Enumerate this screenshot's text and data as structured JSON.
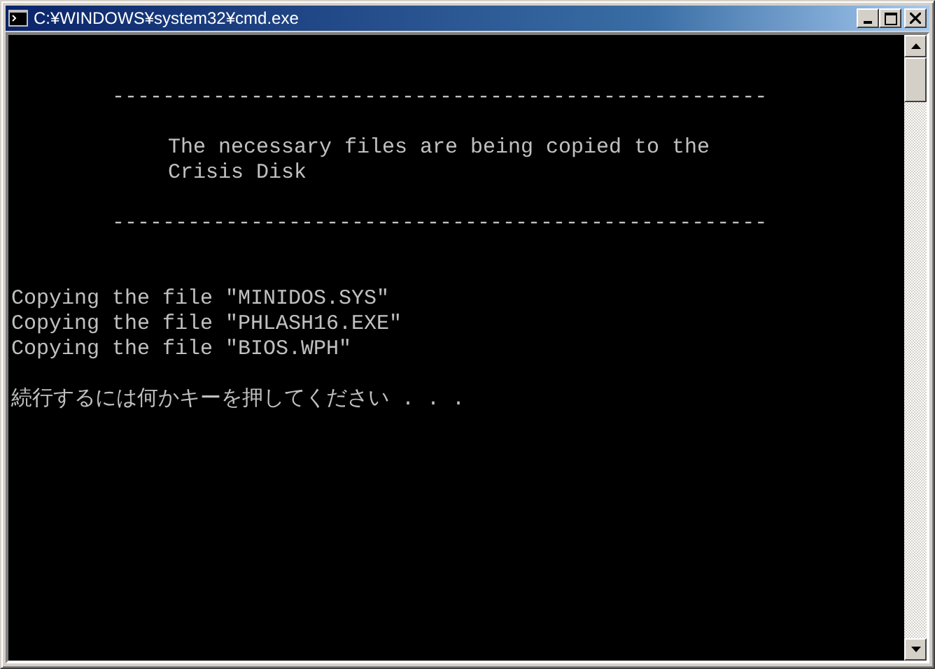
{
  "window": {
    "title": "C:¥WINDOWS¥system32¥cmd.exe"
  },
  "console": {
    "rule_top": "----------------------------------------------------",
    "message": [
      "The necessary files are being copied to the",
      "Crisis Disk"
    ],
    "rule_bottom": "----------------------------------------------------",
    "copy_lines": [
      "Copying the file \"MINIDOS.SYS\"",
      "Copying the file \"PHLASH16.EXE\"",
      "Copying the file \"BIOS.WPH\""
    ],
    "prompt": "続行するには何かキーを押してください . . ."
  }
}
